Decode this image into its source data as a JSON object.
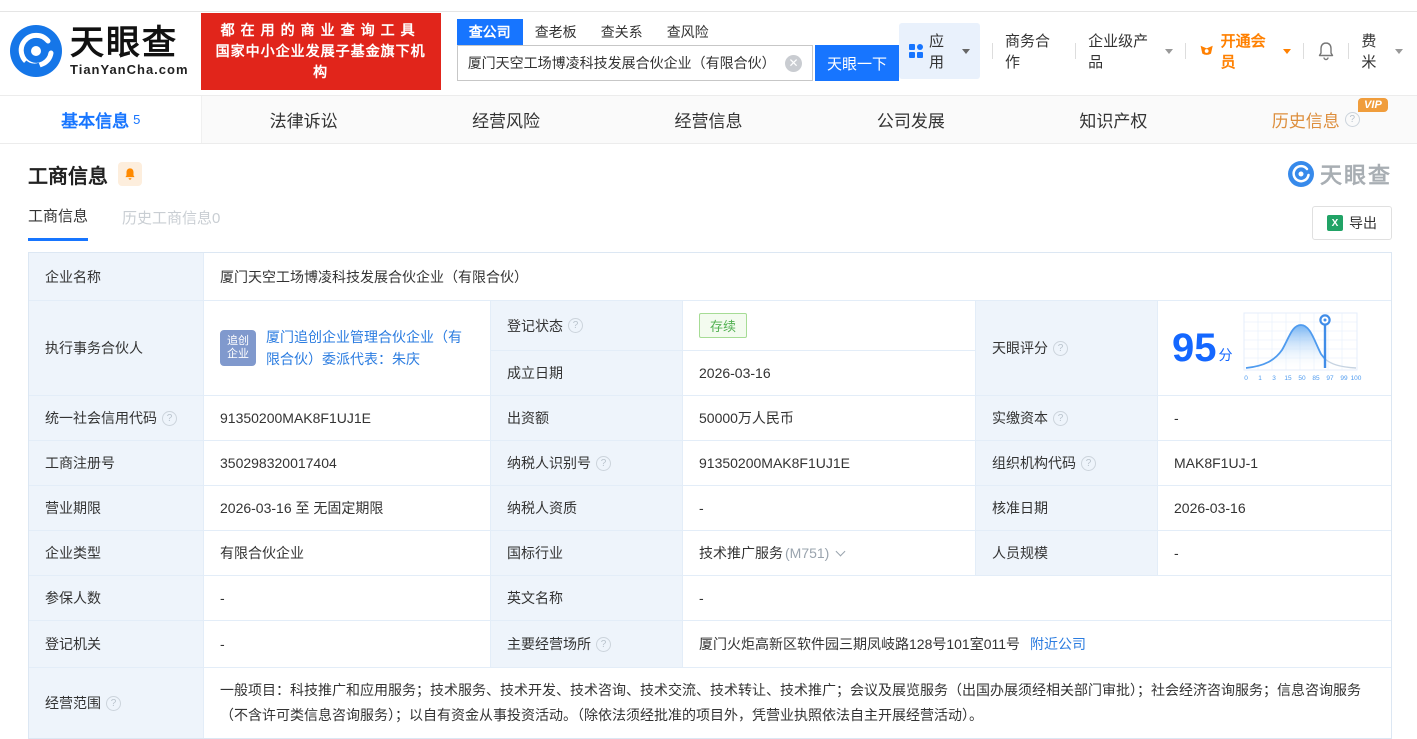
{
  "colors": {
    "accent_blue": "#1775ff",
    "link_blue": "#2b7ce0",
    "score_blue": "#1467ff",
    "banner_red": "#e1251b",
    "vip_orange": "#ff8000",
    "history_tab_orange": "#dd8e3c",
    "status_green": "#52b152",
    "label_cell_bg": "#eef4fb"
  },
  "icons": {
    "help": "?",
    "clear": "✕",
    "excel": "X",
    "bell": "bell",
    "crown": "crown",
    "grid": "apps-grid"
  },
  "header": {
    "logo_title": "天眼查",
    "logo_domain": "TianYanCha.com",
    "banner_line1": "都在用的商业查询工具",
    "banner_line2": "国家中小企业发展子基金旗下机构",
    "search_tabs": [
      {
        "label": "查公司",
        "active": true
      },
      {
        "label": "查老板",
        "active": false
      },
      {
        "label": "查关系",
        "active": false
      },
      {
        "label": "查风险",
        "active": false
      }
    ],
    "search_value": "厦门天空工场博凌科技发展合伙企业（有限合伙）",
    "search_button": "天眼一下",
    "nav": {
      "apps": "应用",
      "cooperation": "商务合作",
      "enterprise": "企业级产品",
      "vip": "开通会员",
      "user": "费米"
    }
  },
  "tabs": [
    {
      "label": "基本信息",
      "count": "5",
      "active": true
    },
    {
      "label": "法律诉讼"
    },
    {
      "label": "经营风险"
    },
    {
      "label": "经营信息"
    },
    {
      "label": "公司发展"
    },
    {
      "label": "知识产权"
    },
    {
      "label": "历史信息",
      "vip": "VIP"
    }
  ],
  "section": {
    "title": "工商信息",
    "subtab_active": "工商信息",
    "subtab_history": "历史工商信息",
    "subtab_history_count": "0",
    "export_label": "导出",
    "watermark": "天眼查"
  },
  "table": {
    "company_name": {
      "label": "企业名称",
      "value": "厦门天空工场博凌科技发展合伙企业（有限合伙）"
    },
    "partner": {
      "label": "执行事务合伙人",
      "badge_line1": "追创",
      "badge_line2": "企业",
      "link": "厦门追创企业管理合伙企业（有限合伙）委派代表：朱庆"
    },
    "reg_status": {
      "label": "登记状态",
      "value": "存续"
    },
    "est_date": {
      "label": "成立日期",
      "value": "2026-03-16"
    },
    "score": {
      "label": "天眼评分",
      "value": "95",
      "unit": "分"
    },
    "credit_code": {
      "label": "统一社会信用代码",
      "value": "91350200MAK8F1UJ1E"
    },
    "capital": {
      "label": "出资额",
      "value": "50000万人民币"
    },
    "paid_capital": {
      "label": "实缴资本",
      "value": "-"
    },
    "reg_number": {
      "label": "工商注册号",
      "value": "350298320017404"
    },
    "taxpayer_id": {
      "label": "纳税人识别号",
      "value": "91350200MAK8F1UJ1E"
    },
    "org_code": {
      "label": "组织机构代码",
      "value": "MAK8F1UJ-1"
    },
    "business_term": {
      "label": "营业期限",
      "value": "2026-03-16 至 无固定期限"
    },
    "taxpayer_quality": {
      "label": "纳税人资质",
      "value": "-"
    },
    "approval_date": {
      "label": "核准日期",
      "value": "2026-03-16"
    },
    "company_type": {
      "label": "企业类型",
      "value": "有限合伙企业"
    },
    "industry": {
      "label": "国标行业",
      "value": "技术推广服务",
      "code": "(M751)"
    },
    "staff_size": {
      "label": "人员规模",
      "value": "-"
    },
    "insured_count": {
      "label": "参保人数",
      "value": "-"
    },
    "english_name": {
      "label": "英文名称",
      "value": "-"
    },
    "reg_authority": {
      "label": "登记机关",
      "value": "-"
    },
    "business_address": {
      "label": "主要经营场所",
      "value": "厦门火炬高新区软件园三期凤岐路128号101室011号",
      "link_label": "附近公司"
    },
    "business_scope": {
      "label": "经营范围",
      "value": "一般项目：科技推广和应用服务；技术服务、技术开发、技术咨询、技术交流、技术转让、技术推广；会议及展览服务（出国办展须经相关部门审批）；社会经济咨询服务；信息咨询服务（不含许可类信息咨询服务）；以自有资金从事投资活动。（除依法须经批准的项目外，凭营业执照依法自主开展经营活动）。"
    }
  },
  "chart_data": {
    "type": "area",
    "title": "天眼评分分布曲线",
    "score": 95,
    "x_scale": "ordinal",
    "x_ticks": [
      "0",
      "1",
      "3",
      "15",
      "50",
      "85",
      "97",
      "99",
      "100"
    ],
    "series": [
      {
        "name": "score-distribution",
        "x": [
          0,
          1,
          3,
          15,
          50,
          85,
          97,
          99,
          100
        ],
        "y_relative": [
          0.02,
          0.05,
          0.12,
          0.45,
          1.0,
          0.45,
          0.1,
          0.04,
          0.02
        ]
      }
    ],
    "marker": {
      "score": 95,
      "between_ticks": [
        "85",
        "97"
      ]
    },
    "grid": true,
    "legend": false
  }
}
